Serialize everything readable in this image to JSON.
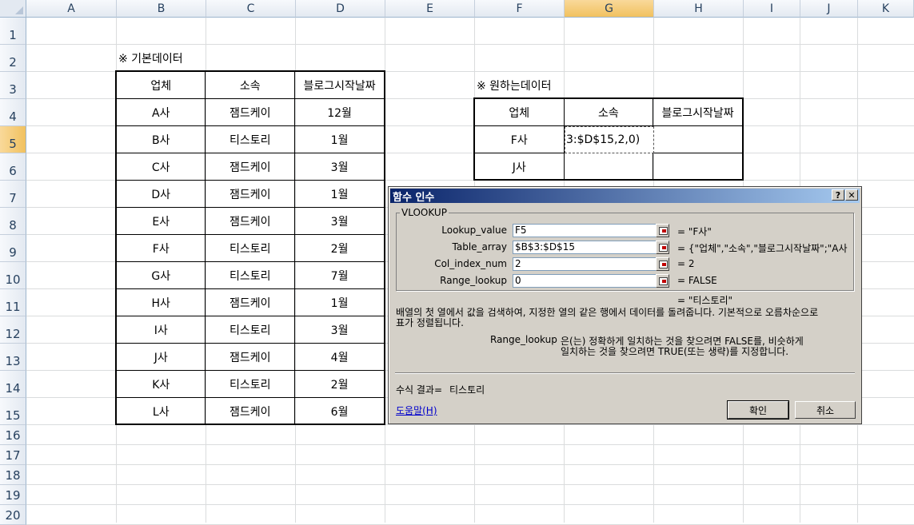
{
  "columns": [
    "A",
    "B",
    "C",
    "D",
    "E",
    "F",
    "G",
    "H",
    "I",
    "J",
    "K"
  ],
  "rows": [
    "1",
    "2",
    "3",
    "4",
    "5",
    "6",
    "7",
    "8",
    "9",
    "10",
    "11",
    "12",
    "13",
    "14",
    "15",
    "16",
    "17",
    "18",
    "19",
    "20"
  ],
  "selected_column": "G",
  "selected_row": "5",
  "source_table": {
    "caption": "※ 기본데이터",
    "headers": [
      "업체",
      "소속",
      "블로그시작날짜"
    ],
    "rows": [
      [
        "A사",
        "잼드케이",
        "12월"
      ],
      [
        "B사",
        "티스토리",
        "1월"
      ],
      [
        "C사",
        "잼드케이",
        "3월"
      ],
      [
        "D사",
        "잼드케이",
        "1월"
      ],
      [
        "E사",
        "잼드케이",
        "3월"
      ],
      [
        "F사",
        "티스토리",
        "2월"
      ],
      [
        "G사",
        "티스토리",
        "7월"
      ],
      [
        "H사",
        "잼드케이",
        "1월"
      ],
      [
        "I사",
        "티스토리",
        "3월"
      ],
      [
        "J사",
        "잼드케이",
        "4월"
      ],
      [
        "K사",
        "티스토리",
        "2월"
      ],
      [
        "L사",
        "잼드케이",
        "6월"
      ]
    ]
  },
  "target_table": {
    "caption": "※ 원하는데이터",
    "headers": [
      "업체",
      "소속",
      "블로그시작날짜"
    ],
    "rows": [
      [
        "F사",
        "",
        ""
      ],
      [
        "J사",
        "",
        ""
      ]
    ],
    "editing_cell_text": "3:$D$15,2,0)"
  },
  "dialog": {
    "title": "함수 인수",
    "help_btn": "?",
    "close_btn": "✕",
    "function_name": "VLOOKUP",
    "args": [
      {
        "label": "Lookup_value",
        "value": "F5",
        "result": "=  \"F사\""
      },
      {
        "label": "Table_array",
        "value": "$B$3:$D$15",
        "result": "=  {\"업체\",\"소속\",\"블로그시작날짜\";\"A사"
      },
      {
        "label": "Col_index_num",
        "value": "2",
        "result": "=  2"
      },
      {
        "label": "Range_lookup",
        "value": "0",
        "result": "=  FALSE"
      }
    ],
    "overall_result": "=  \"티스토리\"",
    "description_line1": "배열의 첫 열에서 값을 검색하여, 지정한 열의 같은 행에서 데이터를 돌려줍니다. 기본적으로 오름차순으로",
    "description_line2": "표가 정렬됩니다.",
    "arg_help_name": "Range_lookup",
    "arg_help_line1": "은(는) 정확하게 일치하는 것을 찾으려면 FALSE를, 비슷하게",
    "arg_help_line2": "일치하는 것을 찾으려면 TRUE(또는 생략)를 지정합니다.",
    "formula_result_label": "수식 결과=",
    "formula_result_value": "티스토리",
    "help_link": "도움말(H)",
    "ok_button": "확인",
    "cancel_button": "취소"
  }
}
